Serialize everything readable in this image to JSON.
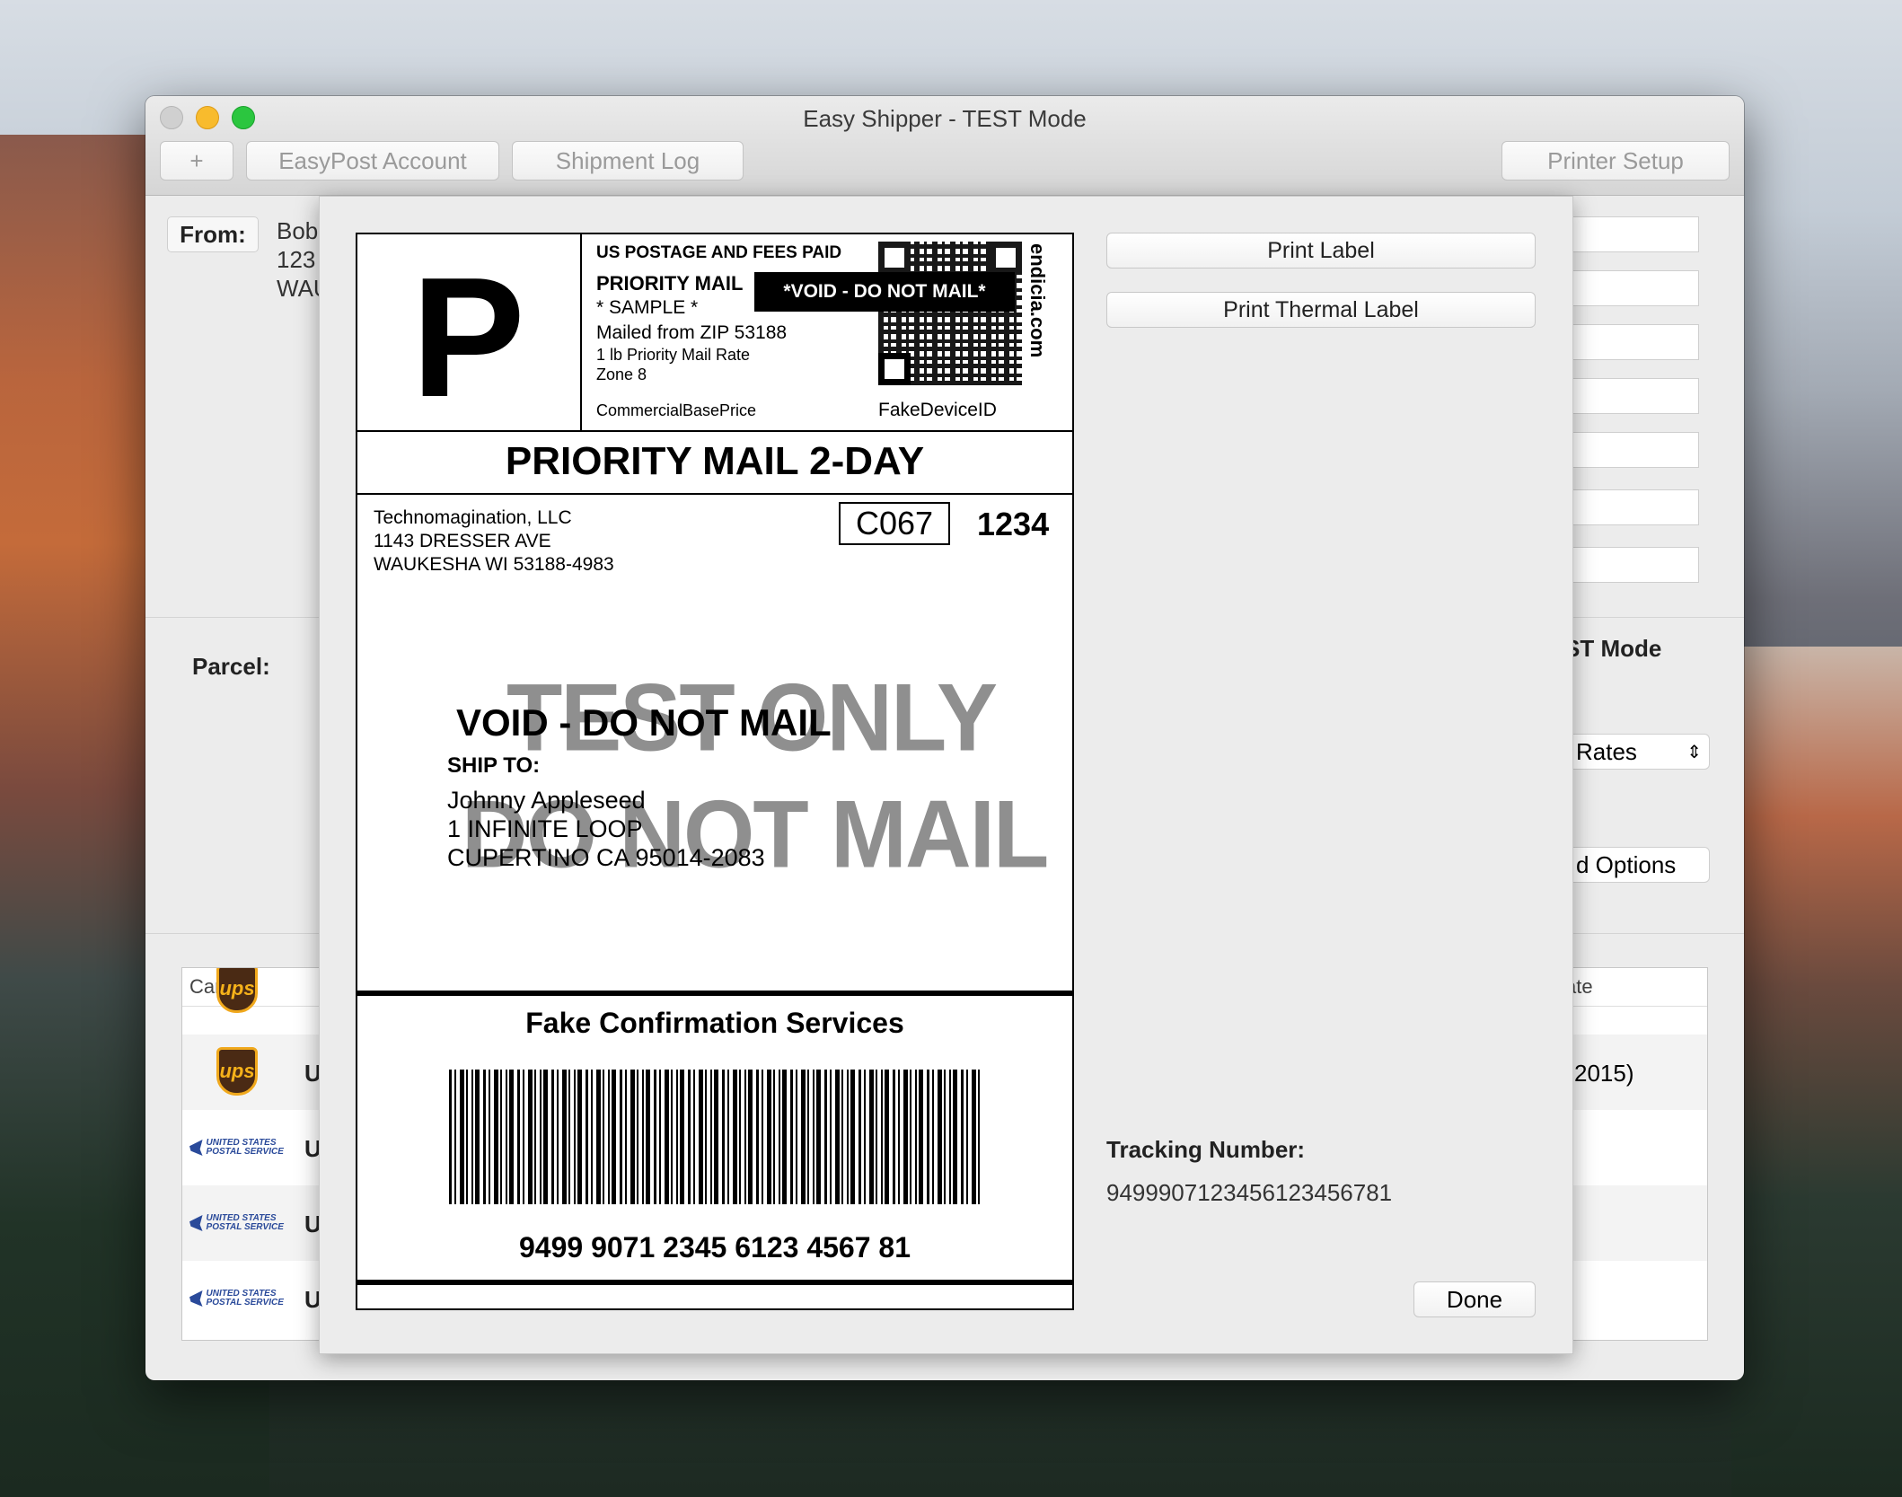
{
  "window": {
    "title": "Easy Shipper - TEST Mode"
  },
  "toolbar": {
    "add_label": "+",
    "easypost_label": "EasyPost Account",
    "shipment_log_label": "Shipment Log",
    "printer_setup_label": "Printer Setup"
  },
  "form": {
    "from_label": "From:",
    "from_lines": [
      "Bob",
      "123",
      "WAU"
    ],
    "parcel_label": "Parcel:",
    "mode_fragment": "ST Mode",
    "rates_fragment": "Rates",
    "options_fragment": "d Options"
  },
  "table": {
    "carrier_header": "Carrier",
    "date_header_fragment": "ate",
    "row_date_fragment": "2015)",
    "row_prefix": "U",
    "usps_logo_text": "UNITED STATES POSTAL SERVICE",
    "ups_logo_text": "ups"
  },
  "label": {
    "class_letter": "P",
    "postage_header": "US POSTAGE AND FEES PAID",
    "service_small": "PRIORITY MAIL",
    "sample": "* SAMPLE *",
    "mailed_from": "Mailed from ZIP 53188",
    "rate": "1 lb Priority Mail Rate",
    "zone": "Zone 8",
    "price_type": "CommercialBasePrice",
    "device_id": "FakeDeviceID",
    "void_badge": "*VOID - DO NOT MAIL*",
    "endicia": "endicia.com",
    "service_title": "PRIORITY MAIL 2-DAY",
    "sender_lines": [
      "Technomagination, LLC",
      "1143 DRESSER AVE",
      "WAUKESHA WI 53188-4983"
    ],
    "route_code": "C067",
    "route_num": "1234",
    "watermark_1": "TEST ONLY",
    "watermark_2": "DO NOT MAIL",
    "void_text": "VOID - DO NOT MAIL",
    "ship_to_label": "SHIP TO:",
    "recipient_lines": [
      "Johnny Appleseed",
      "1 INFINITE LOOP",
      "CUPERTINO CA 95014-2083"
    ],
    "confirmation": "Fake Confirmation Services",
    "barcode_number": "9499 9071 2345 6123 4567 81"
  },
  "sheet": {
    "print_label": "Print Label",
    "print_thermal_label": "Print Thermal Label",
    "tracking_label": "Tracking Number:",
    "tracking_value": "9499907123456123456781",
    "done_label": "Done"
  }
}
